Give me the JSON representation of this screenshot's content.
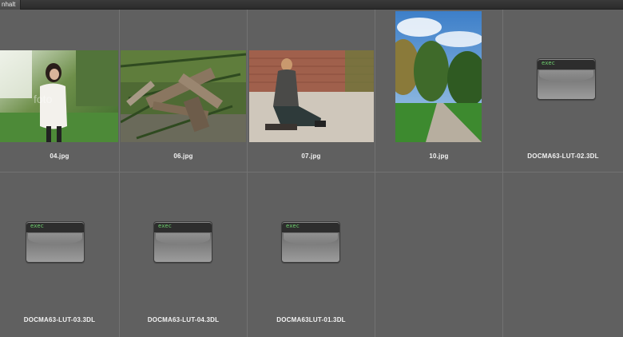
{
  "topbar": {
    "tab_label": "nhalt"
  },
  "files": [
    {
      "name": "04.jpg",
      "kind": "image",
      "watermark": "foto"
    },
    {
      "name": "06.jpg",
      "kind": "image"
    },
    {
      "name": "07.jpg",
      "kind": "image"
    },
    {
      "name": "10.jpg",
      "kind": "image"
    },
    {
      "name": "DOCMA63-LUT-02.3DL",
      "kind": "exec",
      "icon_text": "exec"
    },
    {
      "name": "DOCMA63-LUT-03.3DL",
      "kind": "exec",
      "icon_text": "exec"
    },
    {
      "name": "DOCMA63-LUT-04.3DL",
      "kind": "exec",
      "icon_text": "exec"
    },
    {
      "name": "DOCMA63LUT-01.3DL",
      "kind": "exec",
      "icon_text": "exec"
    }
  ],
  "colors": {
    "background": "#606060",
    "grid_line": "#727272",
    "exec_text": "#6fd36f"
  },
  "icons": {
    "exec_file": "unix-executable-icon"
  }
}
